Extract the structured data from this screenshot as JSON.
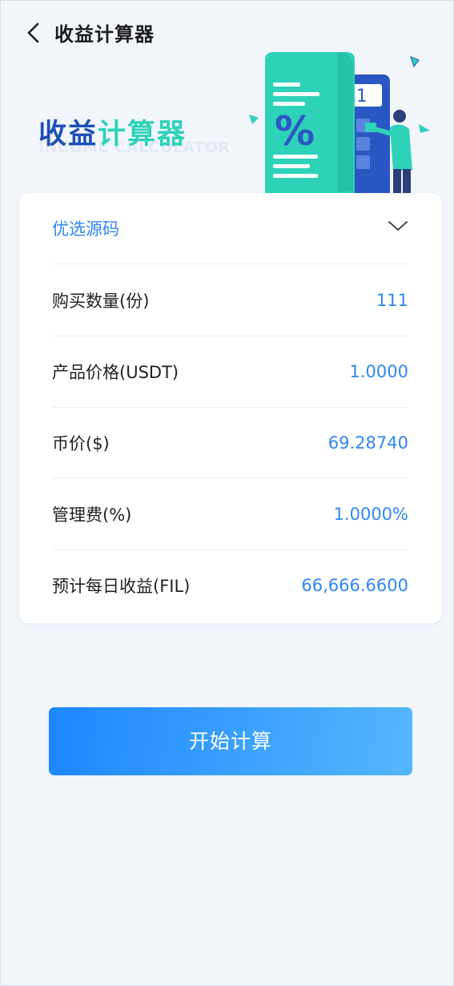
{
  "header": {
    "title": "收益计算器",
    "back_icon": "chevron-left-icon"
  },
  "hero": {
    "title_part1": "收益",
    "title_part2": "计算器",
    "subtitle": "INCOME CALCULATOR",
    "calculator_display": "0971",
    "calculator_symbol": "%",
    "colors": {
      "title_dark": "#1f4fb8",
      "title_accent": "#2ed2b9"
    }
  },
  "form": {
    "source": {
      "value": "优选源码",
      "icon": "chevron-down-icon"
    },
    "rows": [
      {
        "label": "购买数量(份)",
        "value": "111"
      },
      {
        "label": "产品价格(USDT)",
        "value": "1.0000"
      },
      {
        "label": "币价($)",
        "value": "69.28740"
      },
      {
        "label": "管理费(%)",
        "value": "1.0000%"
      },
      {
        "label": "预计每日收益(FIL)",
        "value": "66,666.6600"
      }
    ]
  },
  "actions": {
    "calculate_label": "开始计算"
  },
  "colors": {
    "accent": "#2f86f0",
    "background": "#f2f6fb",
    "button_gradient_start": "#1e86ff",
    "button_gradient_end": "#55b6ff"
  }
}
